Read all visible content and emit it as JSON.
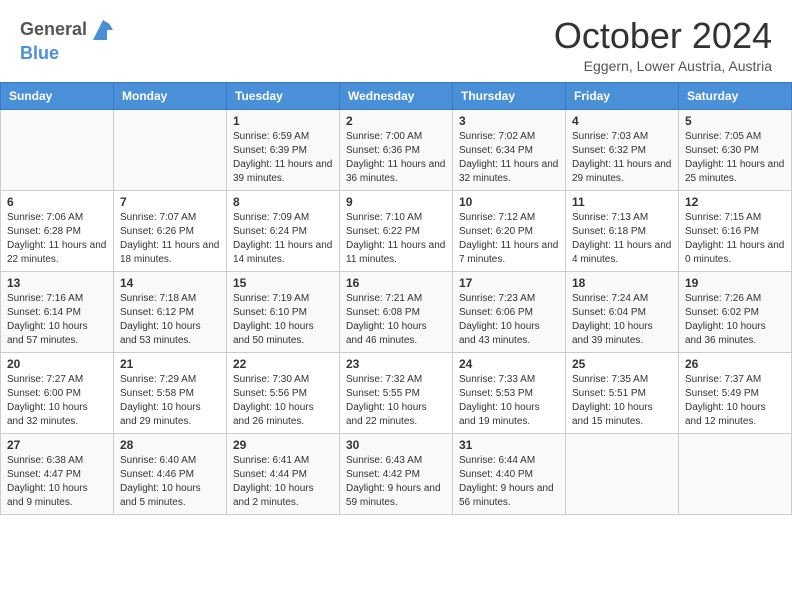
{
  "header": {
    "logo_general": "General",
    "logo_blue": "Blue",
    "month_title": "October 2024",
    "subtitle": "Eggern, Lower Austria, Austria"
  },
  "days_of_week": [
    "Sunday",
    "Monday",
    "Tuesday",
    "Wednesday",
    "Thursday",
    "Friday",
    "Saturday"
  ],
  "weeks": [
    [
      {
        "day": "",
        "detail": ""
      },
      {
        "day": "",
        "detail": ""
      },
      {
        "day": "1",
        "detail": "Sunrise: 6:59 AM\nSunset: 6:39 PM\nDaylight: 11 hours and 39 minutes."
      },
      {
        "day": "2",
        "detail": "Sunrise: 7:00 AM\nSunset: 6:36 PM\nDaylight: 11 hours and 36 minutes."
      },
      {
        "day": "3",
        "detail": "Sunrise: 7:02 AM\nSunset: 6:34 PM\nDaylight: 11 hours and 32 minutes."
      },
      {
        "day": "4",
        "detail": "Sunrise: 7:03 AM\nSunset: 6:32 PM\nDaylight: 11 hours and 29 minutes."
      },
      {
        "day": "5",
        "detail": "Sunrise: 7:05 AM\nSunset: 6:30 PM\nDaylight: 11 hours and 25 minutes."
      }
    ],
    [
      {
        "day": "6",
        "detail": "Sunrise: 7:06 AM\nSunset: 6:28 PM\nDaylight: 11 hours and 22 minutes."
      },
      {
        "day": "7",
        "detail": "Sunrise: 7:07 AM\nSunset: 6:26 PM\nDaylight: 11 hours and 18 minutes."
      },
      {
        "day": "8",
        "detail": "Sunrise: 7:09 AM\nSunset: 6:24 PM\nDaylight: 11 hours and 14 minutes."
      },
      {
        "day": "9",
        "detail": "Sunrise: 7:10 AM\nSunset: 6:22 PM\nDaylight: 11 hours and 11 minutes."
      },
      {
        "day": "10",
        "detail": "Sunrise: 7:12 AM\nSunset: 6:20 PM\nDaylight: 11 hours and 7 minutes."
      },
      {
        "day": "11",
        "detail": "Sunrise: 7:13 AM\nSunset: 6:18 PM\nDaylight: 11 hours and 4 minutes."
      },
      {
        "day": "12",
        "detail": "Sunrise: 7:15 AM\nSunset: 6:16 PM\nDaylight: 11 hours and 0 minutes."
      }
    ],
    [
      {
        "day": "13",
        "detail": "Sunrise: 7:16 AM\nSunset: 6:14 PM\nDaylight: 10 hours and 57 minutes."
      },
      {
        "day": "14",
        "detail": "Sunrise: 7:18 AM\nSunset: 6:12 PM\nDaylight: 10 hours and 53 minutes."
      },
      {
        "day": "15",
        "detail": "Sunrise: 7:19 AM\nSunset: 6:10 PM\nDaylight: 10 hours and 50 minutes."
      },
      {
        "day": "16",
        "detail": "Sunrise: 7:21 AM\nSunset: 6:08 PM\nDaylight: 10 hours and 46 minutes."
      },
      {
        "day": "17",
        "detail": "Sunrise: 7:23 AM\nSunset: 6:06 PM\nDaylight: 10 hours and 43 minutes."
      },
      {
        "day": "18",
        "detail": "Sunrise: 7:24 AM\nSunset: 6:04 PM\nDaylight: 10 hours and 39 minutes."
      },
      {
        "day": "19",
        "detail": "Sunrise: 7:26 AM\nSunset: 6:02 PM\nDaylight: 10 hours and 36 minutes."
      }
    ],
    [
      {
        "day": "20",
        "detail": "Sunrise: 7:27 AM\nSunset: 6:00 PM\nDaylight: 10 hours and 32 minutes."
      },
      {
        "day": "21",
        "detail": "Sunrise: 7:29 AM\nSunset: 5:58 PM\nDaylight: 10 hours and 29 minutes."
      },
      {
        "day": "22",
        "detail": "Sunrise: 7:30 AM\nSunset: 5:56 PM\nDaylight: 10 hours and 26 minutes."
      },
      {
        "day": "23",
        "detail": "Sunrise: 7:32 AM\nSunset: 5:55 PM\nDaylight: 10 hours and 22 minutes."
      },
      {
        "day": "24",
        "detail": "Sunrise: 7:33 AM\nSunset: 5:53 PM\nDaylight: 10 hours and 19 minutes."
      },
      {
        "day": "25",
        "detail": "Sunrise: 7:35 AM\nSunset: 5:51 PM\nDaylight: 10 hours and 15 minutes."
      },
      {
        "day": "26",
        "detail": "Sunrise: 7:37 AM\nSunset: 5:49 PM\nDaylight: 10 hours and 12 minutes."
      }
    ],
    [
      {
        "day": "27",
        "detail": "Sunrise: 6:38 AM\nSunset: 4:47 PM\nDaylight: 10 hours and 9 minutes."
      },
      {
        "day": "28",
        "detail": "Sunrise: 6:40 AM\nSunset: 4:46 PM\nDaylight: 10 hours and 5 minutes."
      },
      {
        "day": "29",
        "detail": "Sunrise: 6:41 AM\nSunset: 4:44 PM\nDaylight: 10 hours and 2 minutes."
      },
      {
        "day": "30",
        "detail": "Sunrise: 6:43 AM\nSunset: 4:42 PM\nDaylight: 9 hours and 59 minutes."
      },
      {
        "day": "31",
        "detail": "Sunrise: 6:44 AM\nSunset: 4:40 PM\nDaylight: 9 hours and 56 minutes."
      },
      {
        "day": "",
        "detail": ""
      },
      {
        "day": "",
        "detail": ""
      }
    ]
  ]
}
